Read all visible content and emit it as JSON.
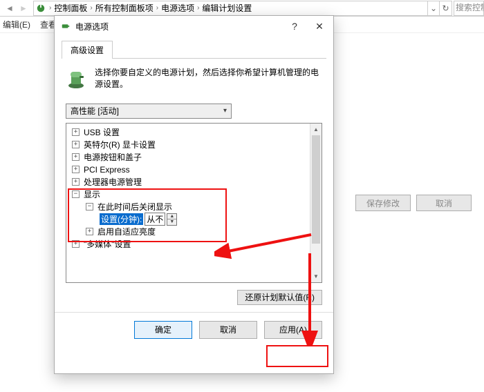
{
  "breadcrumb": {
    "segments": [
      "控制面板",
      "所有控制面板项",
      "电源选项",
      "编辑计划设置"
    ],
    "search_placeholder": "搜索控制"
  },
  "menubar": {
    "edit": "编辑(E)",
    "view": "查看"
  },
  "bg_buttons": {
    "save": "保存修改",
    "cancel": "取消"
  },
  "dialog": {
    "title": "电源选项",
    "tab_label": "高级设置",
    "description": "选择你要自定义的电源计划，然后选择你希望计算机管理的电源设置。",
    "plan_selected": "高性能 [活动]",
    "tree": {
      "usb": "USB 设置",
      "intel_gfx": "英特尔(R) 显卡设置",
      "power_button": "电源按钮和盖子",
      "pci": "PCI Express",
      "cpu": "处理器电源管理",
      "display": "显示",
      "display_off_after": "在此时间后关闭显示",
      "setting_label": "设置(分钟):",
      "setting_value": "从不",
      "adaptive_brightness": "启用自适应亮度",
      "multimedia": "\"多媒体\"设置"
    },
    "restore_defaults": "还原计划默认值(R)",
    "ok": "确定",
    "cancel": "取消",
    "apply": "应用(A)"
  }
}
